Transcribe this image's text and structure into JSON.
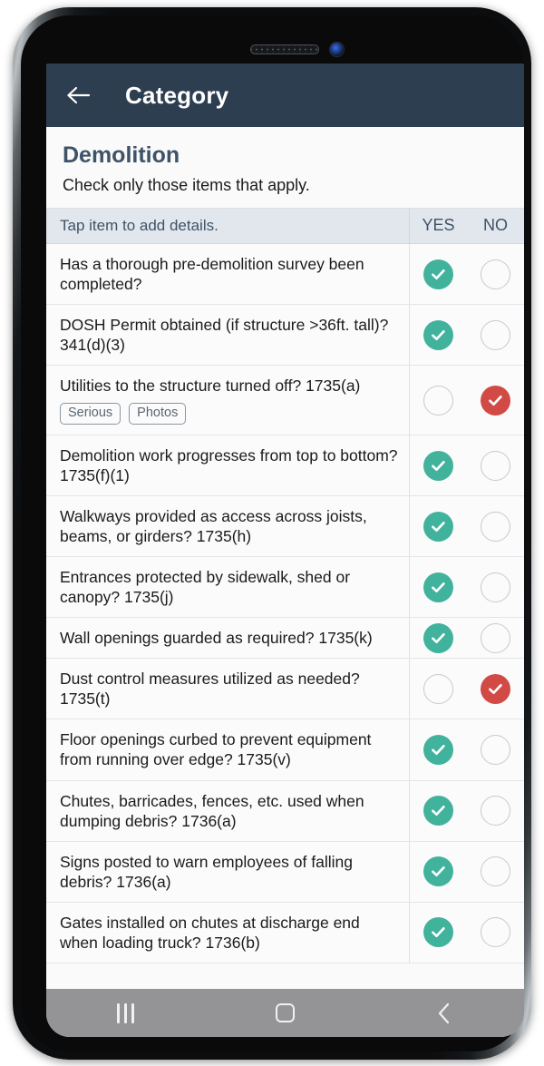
{
  "appbar": {
    "title": "Category",
    "back_icon": "arrow-left-icon"
  },
  "heading": {
    "title": "Demolition",
    "subtitle": "Check only those items that apply."
  },
  "table": {
    "columns": {
      "item": "Tap item to add details.",
      "yes": "YES",
      "no": "NO"
    },
    "rows": [
      {
        "text": "Has a thorough pre-demolition survey been completed?",
        "yes": true,
        "no": false,
        "badges": []
      },
      {
        "text": "DOSH Permit obtained (if structure >36ft. tall)? 341(d)(3)",
        "yes": true,
        "no": false,
        "badges": []
      },
      {
        "text": "Utilities to the structure turned off? 1735(a)",
        "yes": false,
        "no": true,
        "badges": [
          "Serious",
          "Photos"
        ]
      },
      {
        "text": "Demolition work progresses from top to bottom? 1735(f)(1)",
        "yes": true,
        "no": false,
        "badges": []
      },
      {
        "text": "Walkways provided as access across joists, beams, or girders? 1735(h)",
        "yes": true,
        "no": false,
        "badges": []
      },
      {
        "text": "Entrances protected by sidewalk, shed or canopy? 1735(j)",
        "yes": true,
        "no": false,
        "badges": []
      },
      {
        "text": "Wall openings guarded as required? 1735(k)",
        "yes": true,
        "no": false,
        "badges": []
      },
      {
        "text": "Dust control measures utilized as needed? 1735(t)",
        "yes": false,
        "no": true,
        "badges": []
      },
      {
        "text": "Floor openings curbed to prevent equipment from running over edge? 1735(v)",
        "yes": true,
        "no": false,
        "badges": []
      },
      {
        "text": "Chutes, barricades, fences, etc. used when dumping debris? 1736(a)",
        "yes": true,
        "no": false,
        "badges": []
      },
      {
        "text": "Signs posted to warn employees of falling debris? 1736(a)",
        "yes": true,
        "no": false,
        "badges": []
      },
      {
        "text": "Gates installed on chutes at discharge end when loading truck? 1736(b)",
        "yes": true,
        "no": false,
        "badges": []
      }
    ]
  },
  "navbar": {
    "recents_icon": "recents-bars-icon",
    "home_icon": "home-square-icon",
    "back_icon": "back-chevron-icon"
  },
  "colors": {
    "appbar": "#2d3e50",
    "yes_accent": "#41b29b",
    "no_accent": "#d24a45",
    "heading": "#3e5368",
    "table_header_bg": "#e2e7ed",
    "navbar": "#949497"
  }
}
